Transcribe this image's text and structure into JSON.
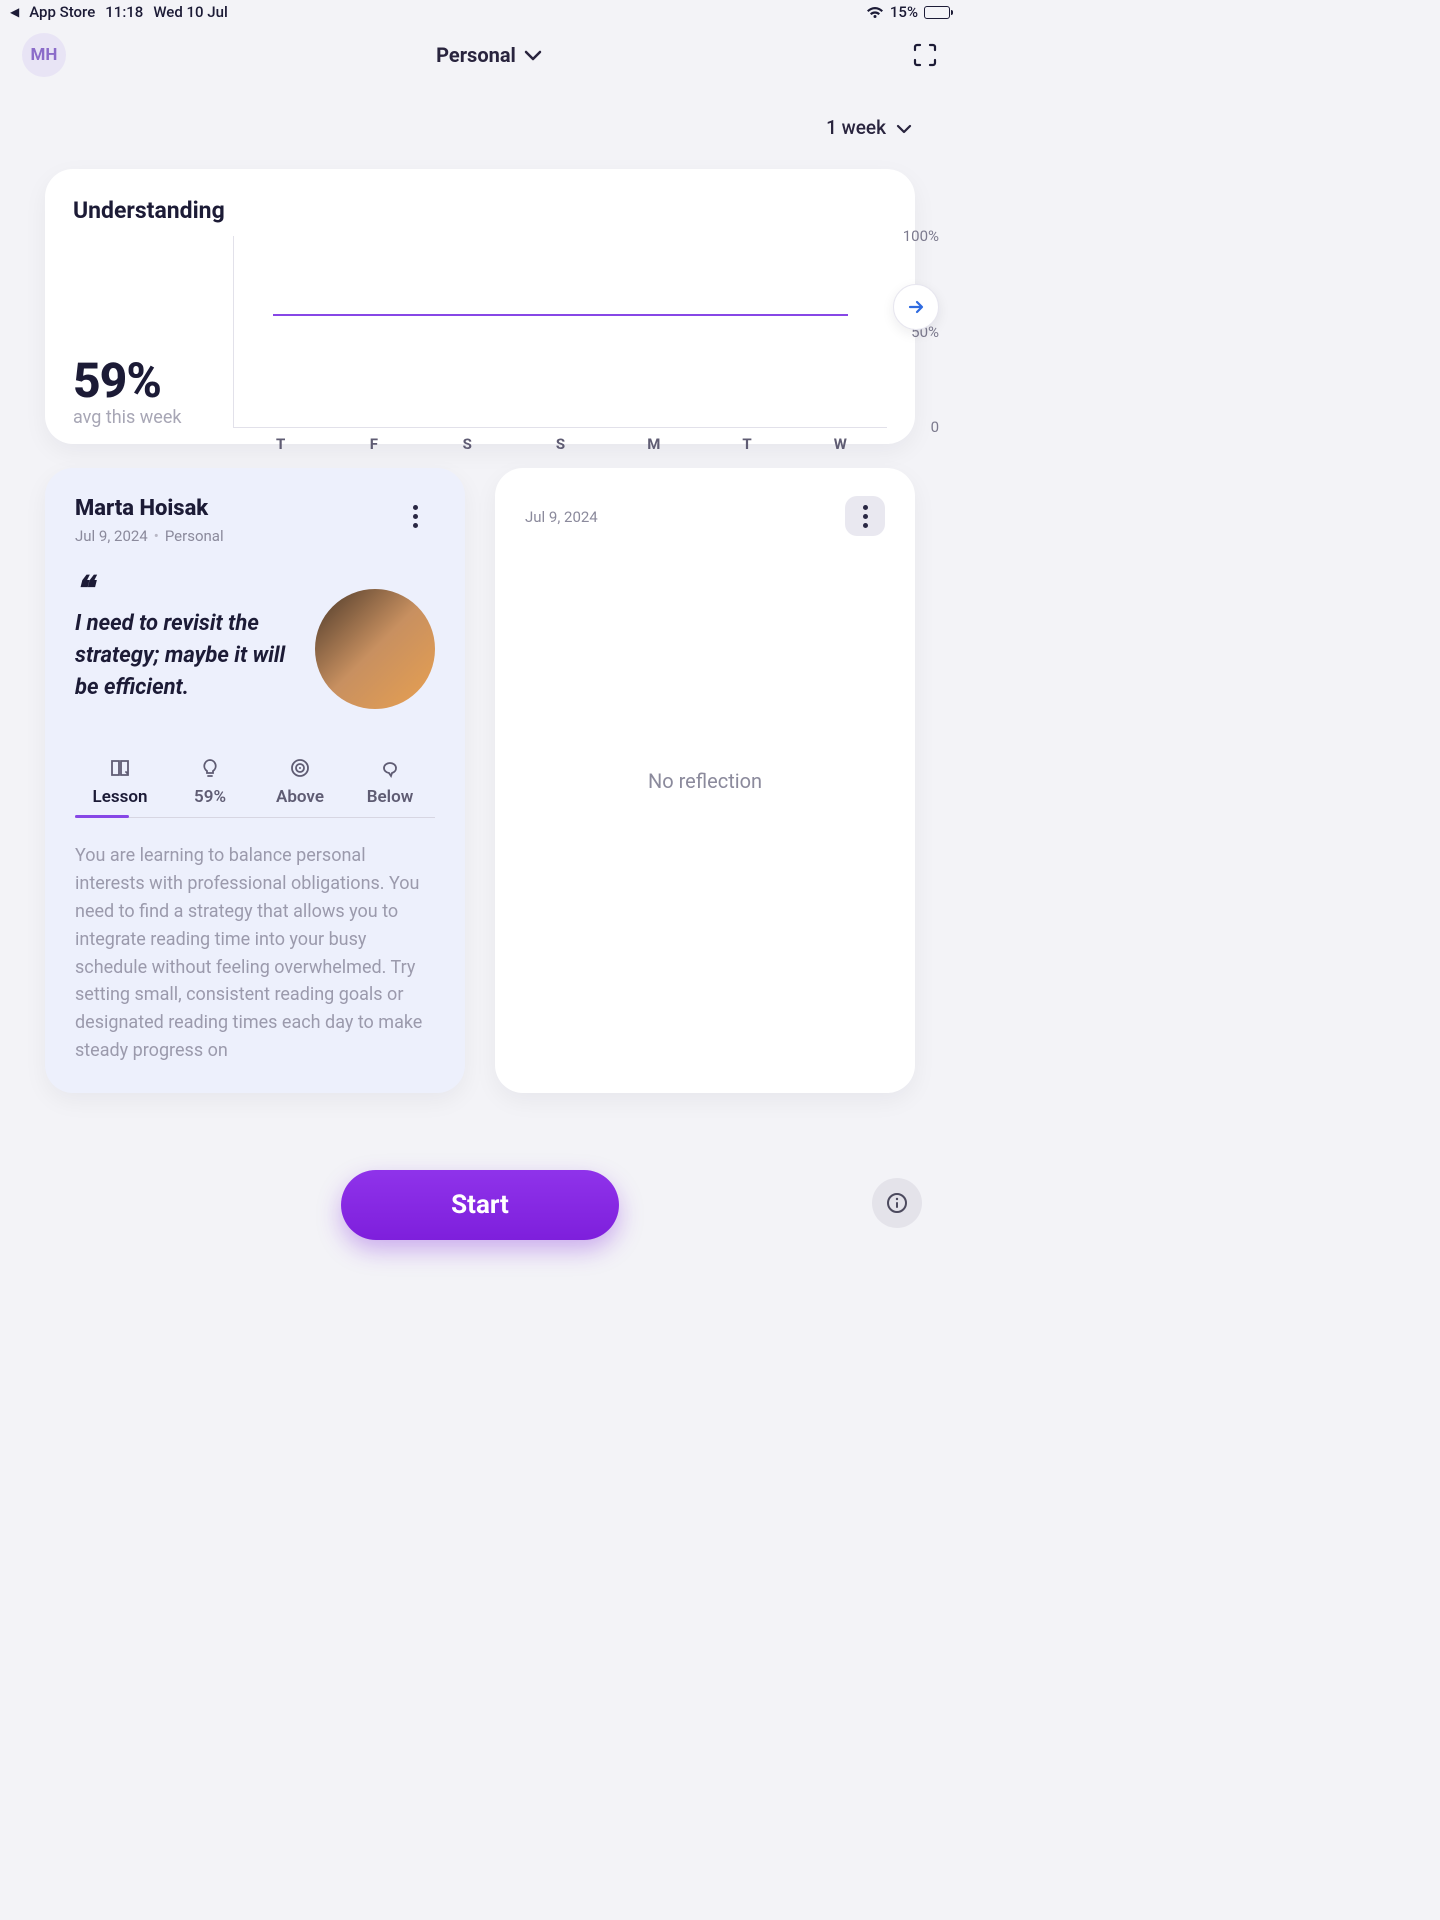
{
  "status_bar": {
    "back_label": "App Store",
    "time": "11:18",
    "date": "Wed 10 Jul",
    "battery_pct": "15%"
  },
  "header": {
    "avatar_initials": "MH",
    "filter_label": "Personal"
  },
  "timerange": {
    "label": "1 week"
  },
  "chart_card": {
    "title": "Understanding",
    "big_value": "59%",
    "subtitle": "avg this week"
  },
  "chart_data": {
    "type": "line",
    "categories": [
      "T",
      "F",
      "S",
      "S",
      "M",
      "T",
      "W"
    ],
    "values": [
      null,
      59,
      59,
      59,
      59,
      59,
      59
    ],
    "yticks": [
      "0",
      "50%",
      "100%"
    ],
    "ylim": [
      0,
      100
    ],
    "title": "Understanding",
    "ylabel": "",
    "xlabel": ""
  },
  "card_left": {
    "author": "Marta Hoisak",
    "date": "Jul 9, 2024",
    "scope": "Personal",
    "quote": "I need to revisit the strategy; maybe it will be efficient.",
    "tabs": {
      "lesson": "Lesson",
      "pct": "59%",
      "above": "Above",
      "below": "Below"
    },
    "lesson_text": "You are learning to balance personal interests with professional obligations. You need to find a strategy that allows you to integrate reading time into your busy schedule without feeling overwhelmed. Try setting small, consistent reading goals or designated reading times each day to make steady progress on"
  },
  "card_right": {
    "date": "Jul 9, 2024",
    "empty_text": "No reflection"
  },
  "start_button": "Start"
}
